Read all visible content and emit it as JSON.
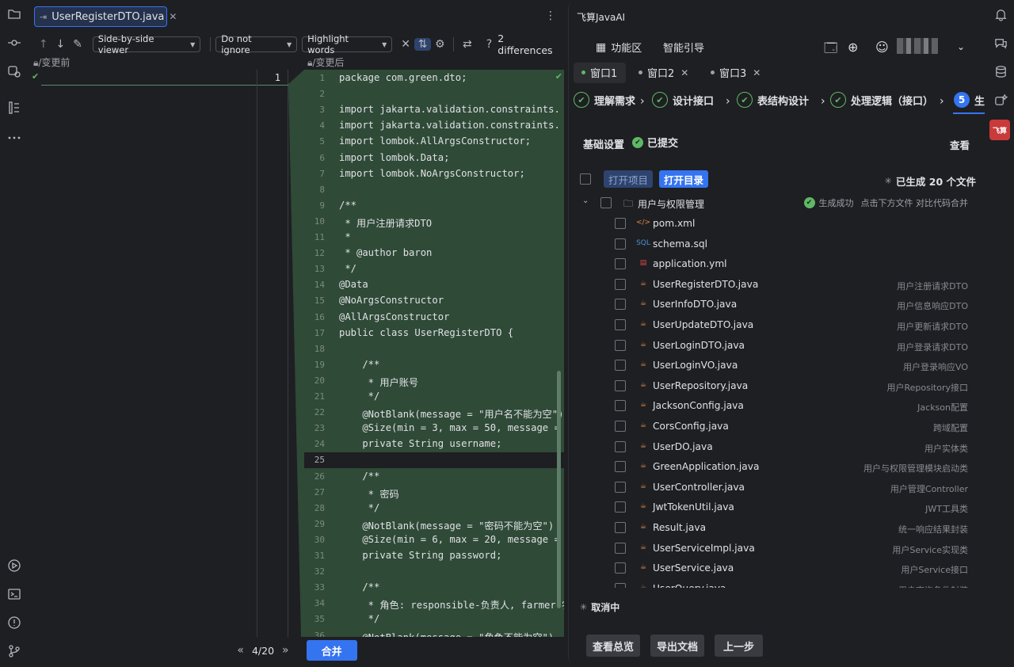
{
  "diff": {
    "tab_title": "UserRegisterDTO.java",
    "toolbar": {
      "viewer": "Side-by-side viewer",
      "ignore": "Do not ignore",
      "highlight": "Highlight words",
      "differences": "2 differences"
    },
    "left_label": "/变更前",
    "right_label": "/变更后",
    "left_line_number": "1",
    "lines": [
      {
        "n": "1",
        "t": "package com.green.dto;"
      },
      {
        "n": "2",
        "t": ""
      },
      {
        "n": "3",
        "t": "import jakarta.validation.constraints."
      },
      {
        "n": "4",
        "t": "import jakarta.validation.constraints."
      },
      {
        "n": "5",
        "t": "import lombok.AllArgsConstructor;"
      },
      {
        "n": "6",
        "t": "import lombok.Data;"
      },
      {
        "n": "7",
        "t": "import lombok.NoArgsConstructor;"
      },
      {
        "n": "8",
        "t": ""
      },
      {
        "n": "9",
        "t": "/**"
      },
      {
        "n": "10",
        "t": " * 用户注册请求DTO"
      },
      {
        "n": "11",
        "t": " *"
      },
      {
        "n": "12",
        "t": " * @author baron"
      },
      {
        "n": "13",
        "t": " */"
      },
      {
        "n": "14",
        "t": "@Data"
      },
      {
        "n": "15",
        "t": "@NoArgsConstructor"
      },
      {
        "n": "16",
        "t": "@AllArgsConstructor"
      },
      {
        "n": "17",
        "t": "public class UserRegisterDTO {"
      },
      {
        "n": "18",
        "t": ""
      },
      {
        "n": "19",
        "t": "    /**"
      },
      {
        "n": "20",
        "t": "     * 用户账号"
      },
      {
        "n": "21",
        "t": "     */"
      },
      {
        "n": "22",
        "t": "    @NotBlank(message = \"用户名不能为空\")"
      },
      {
        "n": "23",
        "t": "    @Size(min = 3, max = 50, message ="
      },
      {
        "n": "24",
        "t": "    private String username;"
      },
      {
        "n": "25",
        "t": ""
      },
      {
        "n": "26",
        "t": "    /**"
      },
      {
        "n": "27",
        "t": "     * 密码"
      },
      {
        "n": "28",
        "t": "     */"
      },
      {
        "n": "29",
        "t": "    @NotBlank(message = \"密码不能为空\")"
      },
      {
        "n": "30",
        "t": "    @Size(min = 6, max = 20, message ="
      },
      {
        "n": "31",
        "t": "    private String password;"
      },
      {
        "n": "32",
        "t": ""
      },
      {
        "n": "33",
        "t": "    /**"
      },
      {
        "n": "34",
        "t": "     * 角色: responsible-负责人, farmer-农"
      },
      {
        "n": "35",
        "t": "     */"
      },
      {
        "n": "36",
        "t": "    @NotBlank(message = \"角色不能为空\")"
      }
    ],
    "current_line": "25",
    "page_indicator": "4/20",
    "merge_label": "合并"
  },
  "ai": {
    "title": "飞算JavaAI",
    "header": {
      "workspace": "功能区",
      "guide": "智能引导"
    },
    "window_tabs": [
      "窗口1",
      "窗口2",
      "窗口3"
    ],
    "steps": [
      "理解需求",
      "设计接口",
      "表结构设计",
      "处理逻辑（接口）"
    ],
    "current_step_num": "5",
    "current_step_label": "生",
    "basic_label": "基础设置",
    "basic_status": "已提交",
    "view_label": "查看",
    "open_project": "打开项目",
    "open_dir": "打开目录",
    "generated_count": "已生成 20 个文件",
    "folder": {
      "name": "用户与权限管理",
      "status": "生成成功",
      "hint": "点击下方文件 对比代码合并"
    },
    "files": [
      {
        "name": "pom.xml",
        "desc": "",
        "icon": "xml"
      },
      {
        "name": "schema.sql",
        "desc": "",
        "icon": "sql"
      },
      {
        "name": "application.yml",
        "desc": "",
        "icon": "yml"
      },
      {
        "name": "UserRegisterDTO.java",
        "desc": "用户注册请求DTO",
        "icon": "java"
      },
      {
        "name": "UserInfoDTO.java",
        "desc": "用户信息响应DTO",
        "icon": "java"
      },
      {
        "name": "UserUpdateDTO.java",
        "desc": "用户更新请求DTO",
        "icon": "java"
      },
      {
        "name": "UserLoginDTO.java",
        "desc": "用户登录请求DTO",
        "icon": "java"
      },
      {
        "name": "UserLoginVO.java",
        "desc": "用户登录响应VO",
        "icon": "java"
      },
      {
        "name": "UserRepository.java",
        "desc": "用户Repository接口",
        "icon": "java"
      },
      {
        "name": "JacksonConfig.java",
        "desc": "Jackson配置",
        "icon": "java"
      },
      {
        "name": "CorsConfig.java",
        "desc": "跨域配置",
        "icon": "java"
      },
      {
        "name": "UserDO.java",
        "desc": "用户实体类",
        "icon": "java"
      },
      {
        "name": "GreenApplication.java",
        "desc": "用户与权限管理模块启动类",
        "icon": "java"
      },
      {
        "name": "UserController.java",
        "desc": "用户管理Controller",
        "icon": "java"
      },
      {
        "name": "JwtTokenUtil.java",
        "desc": "JWT工具类",
        "icon": "java"
      },
      {
        "name": "Result.java",
        "desc": "统一响应结果封装",
        "icon": "java"
      },
      {
        "name": "UserServiceImpl.java",
        "desc": "用户Service实现类",
        "icon": "java"
      },
      {
        "name": "UserService.java",
        "desc": "用户Service接口",
        "icon": "java"
      },
      {
        "name": "UserQuery.java",
        "desc": "用户查询条件封装",
        "icon": "java"
      }
    ],
    "cancel_label": "取消中",
    "buttons": {
      "overview": "查看总览",
      "export": "导出文档",
      "prev": "上一步"
    },
    "badge_label": "飞算"
  },
  "colors": {
    "accent": "#3574f0",
    "added_bg": "#2f4a37",
    "success": "#5fb865"
  }
}
